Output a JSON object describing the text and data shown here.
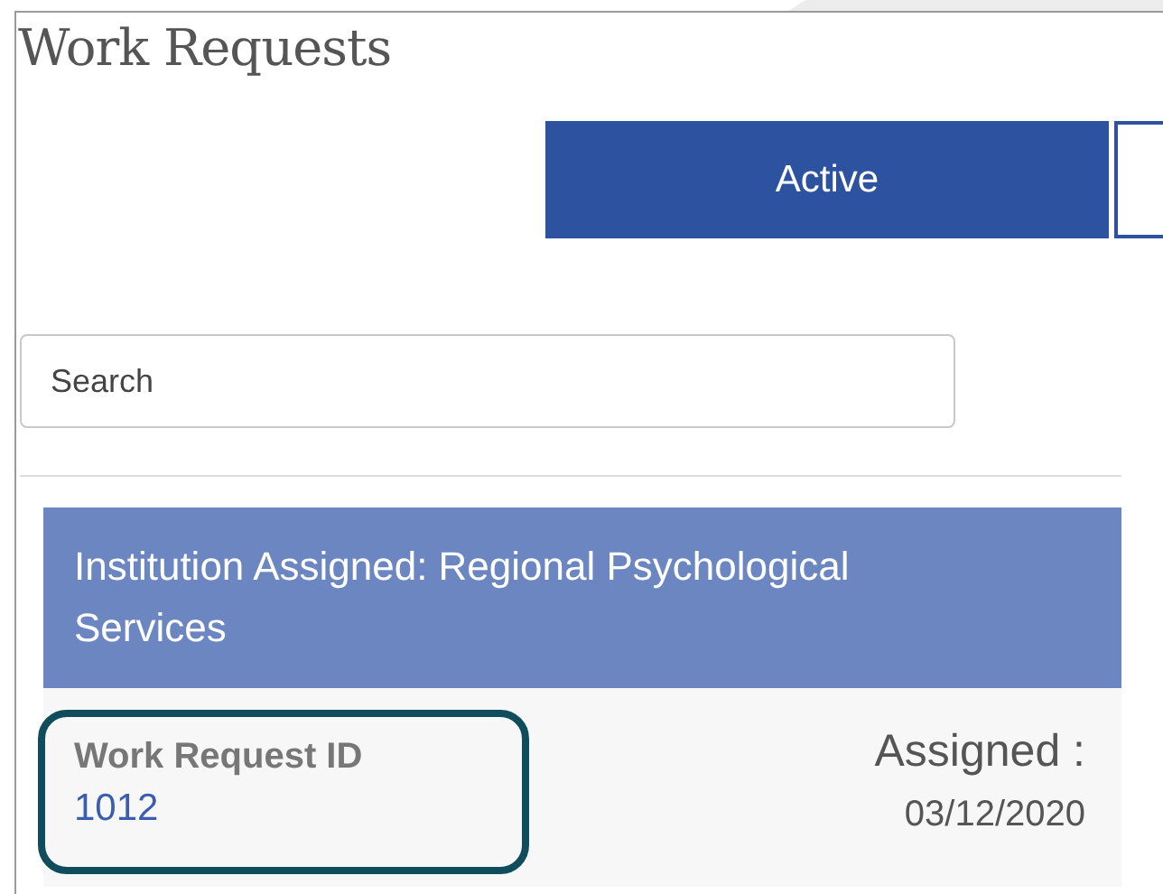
{
  "title": "Work Requests",
  "tabs": [
    {
      "label": "Active",
      "selected": true
    }
  ],
  "search": {
    "placeholder": "Search"
  },
  "group": {
    "header": "Institution Assigned: Regional Psychological Services",
    "items": [
      {
        "id_label": "Work Request ID",
        "id": "1012",
        "assigned_label": "Assigned :",
        "assigned_date": "03/12/2020",
        "highlighted": true
      }
    ]
  }
}
